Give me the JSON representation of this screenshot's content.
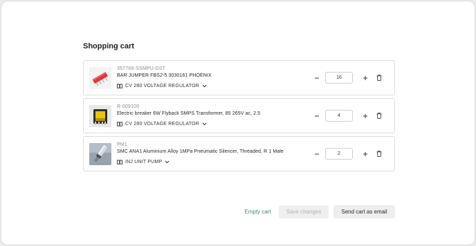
{
  "page": {
    "title": "Shopping cart"
  },
  "icons": {
    "machine": "book-icon",
    "dropdown": "chevron-down-icon",
    "decrease": "minus-icon",
    "increase": "plus-icon",
    "remove": "trash-icon"
  },
  "items": [
    {
      "sku": "357766-SSMPU-DST",
      "name": "BAR JUMPER FBS2-5 3030161 PHOENIX",
      "machine": "CV 280 VOLTAGE REGULATOR",
      "quantity": "16",
      "image": "red-bar-jumper"
    },
    {
      "sku": "R-009100",
      "name": "Electric breaker 6W Flyback SMPS Transformer, 85 265V ac, 2.5",
      "machine": "CV 280 VOLTAGE REGULATOR",
      "quantity": "4",
      "image": "transformer"
    },
    {
      "sku": "PM1",
      "name": "SMC ANA1 Aluminium Alloy 1MPa Pneumatic Silencer, Threaded, R 1 Male",
      "machine": "INJ UNIT PUMP",
      "quantity": "2",
      "image": "pneumatic-silencer"
    }
  ],
  "footer": {
    "empty_label": "Empty cart",
    "save_label": "Save changes",
    "email_label": "Send cart as email"
  },
  "colors": {
    "accent": "#3f8f6f",
    "border": "#dedede",
    "disabled_text": "#b4b4b4"
  }
}
